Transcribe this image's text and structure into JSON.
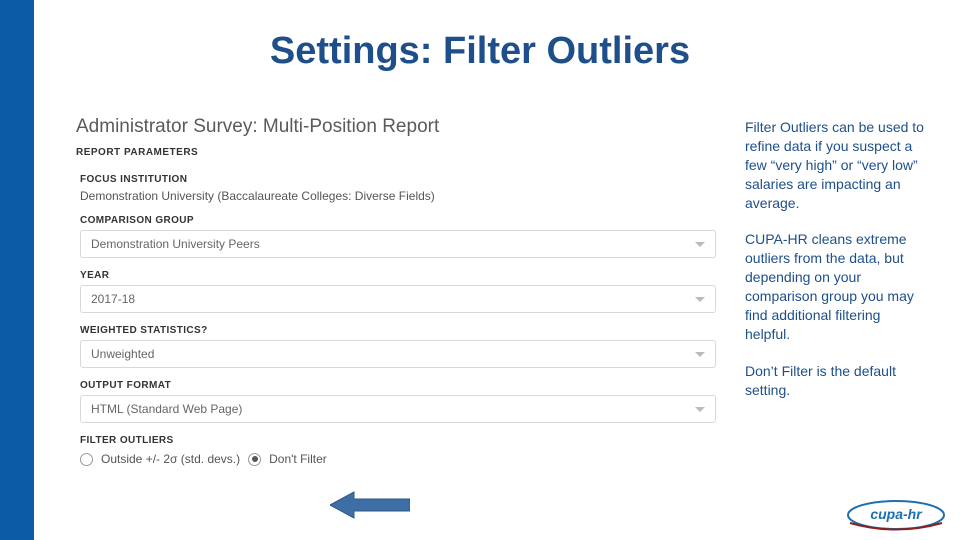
{
  "slide": {
    "title": "Settings: Filter Outliers"
  },
  "report": {
    "title": "Administrator Survey: Multi-Position Report",
    "badge": "REPORT PARAMETERS"
  },
  "labels": {
    "focus_institution": "FOCUS INSTITUTION",
    "comparison_group": "COMPARISON GROUP",
    "year": "YEAR",
    "weighted": "WEIGHTED STATISTICS?",
    "output_format": "OUTPUT FORMAT",
    "filter_outliers": "FILTER OUTLIERS"
  },
  "values": {
    "focus_institution": "Demonstration University (Baccalaureate Colleges: Diverse Fields)",
    "comparison_group": "Demonstration University Peers",
    "year": "2017-18",
    "weighted": "Unweighted",
    "output_format": "HTML (Standard Web Page)"
  },
  "radios": {
    "option1": "Outside +/- 2σ (std. devs.)",
    "option2": "Don't Filter"
  },
  "sidebar": {
    "p1": "Filter Outliers can be used to refine data if you suspect a few “very high” or “very low” salaries are impacting an average.",
    "p2": "CUPA-HR cleans extreme outliers from the data, but depending on your comparison group you may find additional filtering helpful.",
    "p3": "Don’t Filter is the default setting."
  },
  "logo": {
    "text": "cupa-hr"
  }
}
